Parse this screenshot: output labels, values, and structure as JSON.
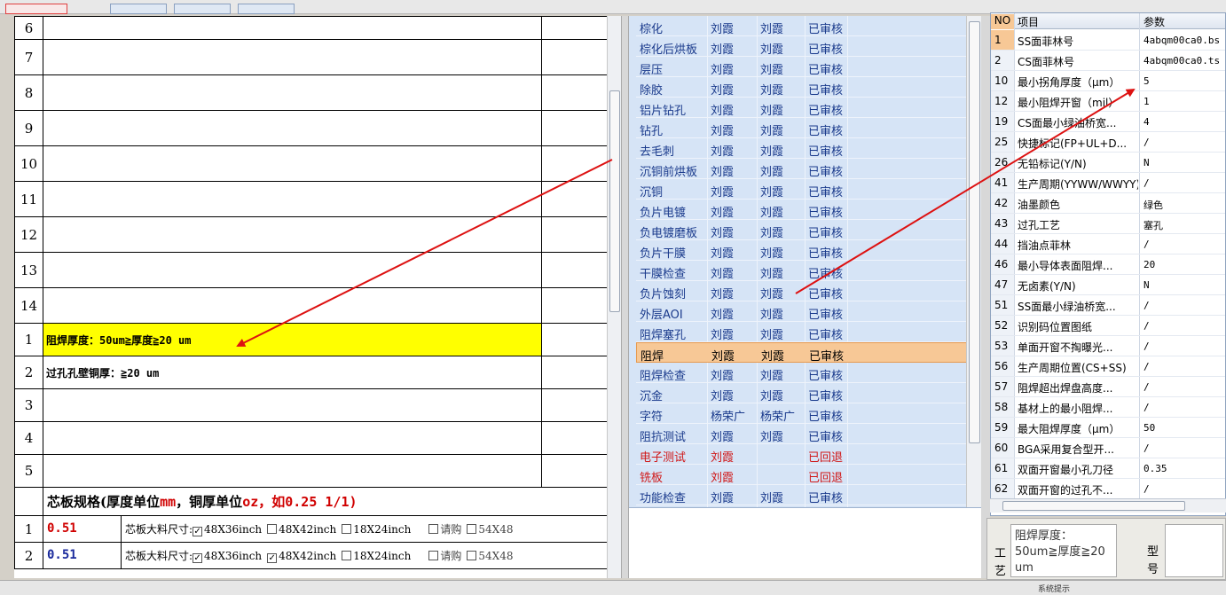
{
  "left_sheet": {
    "top_rows": [
      {
        "num": "6",
        "text": ""
      },
      {
        "num": "7",
        "text": ""
      },
      {
        "num": "8",
        "text": ""
      },
      {
        "num": "9",
        "text": ""
      },
      {
        "num": "10",
        "text": ""
      },
      {
        "num": "11",
        "text": ""
      },
      {
        "num": "12",
        "text": ""
      },
      {
        "num": "13",
        "text": ""
      },
      {
        "num": "14",
        "text": ""
      }
    ],
    "notes": [
      {
        "num": "1",
        "text": "阻焊厚度：50um≧厚度≧20 um",
        "highlight": true
      },
      {
        "num": "2",
        "text": "过孔孔壁铜厚：≧20 um",
        "highlight": false
      },
      {
        "num": "3",
        "text": "",
        "highlight": false
      },
      {
        "num": "4",
        "text": "",
        "highlight": false
      },
      {
        "num": "5",
        "text": "",
        "highlight": false
      }
    ],
    "spec_title_a": "芯板规格(厚度单位",
    "spec_unit_a": "mm",
    "spec_title_b": "，铜厚单位",
    "spec_unit_b": "oz",
    "spec_title_c": "，如0.25 1/1)",
    "core_rows": [
      {
        "num": "1",
        "value": "0.51",
        "value_color": "#d00000",
        "label": "芯板大料尺寸:",
        "opt1": "48X36inch",
        "opt1_checked": "✓",
        "opt2": "48X42inch",
        "opt2_checked": "",
        "opt3": "18X24inch",
        "opt4": "请购",
        "opt5": "54X48"
      },
      {
        "num": "2",
        "value": "0.51",
        "value_color": "#1a2a9c",
        "label": "芯板大料尺寸:",
        "opt1": "48X36inch",
        "opt1_checked": "✓",
        "opt2": "48X42inch",
        "opt2_checked": "✓",
        "opt3": "18X24inch",
        "opt4": "请购",
        "opt5": "54X48"
      }
    ]
  },
  "process_list": {
    "rows": [
      {
        "name": "棕化",
        "op1": "刘霞",
        "op2": "刘霞",
        "status": "已审核",
        "state": "ok"
      },
      {
        "name": "棕化后烘板",
        "op1": "刘霞",
        "op2": "刘霞",
        "status": "已审核",
        "state": "ok"
      },
      {
        "name": "层压",
        "op1": "刘霞",
        "op2": "刘霞",
        "status": "已审核",
        "state": "ok"
      },
      {
        "name": "除胶",
        "op1": "刘霞",
        "op2": "刘霞",
        "status": "已审核",
        "state": "ok"
      },
      {
        "name": "铝片钻孔",
        "op1": "刘霞",
        "op2": "刘霞",
        "status": "已审核",
        "state": "ok"
      },
      {
        "name": "钻孔",
        "op1": "刘霞",
        "op2": "刘霞",
        "status": "已审核",
        "state": "ok"
      },
      {
        "name": "去毛刺",
        "op1": "刘霞",
        "op2": "刘霞",
        "status": "已审核",
        "state": "ok"
      },
      {
        "name": "沉铜前烘板",
        "op1": "刘霞",
        "op2": "刘霞",
        "status": "已审核",
        "state": "ok"
      },
      {
        "name": "沉铜",
        "op1": "刘霞",
        "op2": "刘霞",
        "status": "已审核",
        "state": "ok"
      },
      {
        "name": "负片电镀",
        "op1": "刘霞",
        "op2": "刘霞",
        "status": "已审核",
        "state": "ok"
      },
      {
        "name": "负电镀磨板",
        "op1": "刘霞",
        "op2": "刘霞",
        "status": "已审核",
        "state": "ok"
      },
      {
        "name": "负片干膜",
        "op1": "刘霞",
        "op2": "刘霞",
        "status": "已审核",
        "state": "ok"
      },
      {
        "name": "干膜检查",
        "op1": "刘霞",
        "op2": "刘霞",
        "status": "已审核",
        "state": "ok"
      },
      {
        "name": "负片蚀刻",
        "op1": "刘霞",
        "op2": "刘霞",
        "status": "已审核",
        "state": "ok"
      },
      {
        "name": "外层AOI",
        "op1": "刘霞",
        "op2": "刘霞",
        "status": "已审核",
        "state": "ok"
      },
      {
        "name": "阻焊塞孔",
        "op1": "刘霞",
        "op2": "刘霞",
        "status": "已审核",
        "state": "ok"
      },
      {
        "name": "阻焊",
        "op1": "刘霞",
        "op2": "刘霞",
        "status": "已审核",
        "state": "sel"
      },
      {
        "name": "阻焊检查",
        "op1": "刘霞",
        "op2": "刘霞",
        "status": "已审核",
        "state": "ok"
      },
      {
        "name": "沉金",
        "op1": "刘霞",
        "op2": "刘霞",
        "status": "已审核",
        "state": "ok"
      },
      {
        "name": "字符",
        "op1": "杨荣广",
        "op2": "杨荣广",
        "status": "已审核",
        "state": "ok"
      },
      {
        "name": "阻抗测试",
        "op1": "刘霞",
        "op2": "刘霞",
        "status": "已审核",
        "state": "ok"
      },
      {
        "name": "电子测试",
        "op1": "刘霞",
        "op2": "",
        "status": "已回退",
        "state": "back"
      },
      {
        "name": "铣板",
        "op1": "刘霞",
        "op2": "",
        "status": "已回退",
        "state": "back"
      },
      {
        "name": "功能检查",
        "op1": "刘霞",
        "op2": "刘霞",
        "status": "已审核",
        "state": "ok"
      }
    ]
  },
  "param_grid": {
    "headers": {
      "no": "NO",
      "item": "项目",
      "value": "参数"
    },
    "rows": [
      {
        "no": "1",
        "item": "SS面菲林号",
        "value": "4abqm00ca0.bs"
      },
      {
        "no": "2",
        "item": "CS面菲林号",
        "value": "4abqm00ca0.ts"
      },
      {
        "no": "10",
        "item": "最小拐角厚度（μm）",
        "value": "5"
      },
      {
        "no": "12",
        "item": "最小阻焊开窗（mil）",
        "value": "1"
      },
      {
        "no": "19",
        "item": "CS面最小绿油桥宽...",
        "value": "4"
      },
      {
        "no": "25",
        "item": "快捷标记(FP+UL+D...",
        "value": "/"
      },
      {
        "no": "26",
        "item": "无铅标记(Y/N)",
        "value": "N"
      },
      {
        "no": "41",
        "item": "生产周期(YYWW/WWYY)",
        "value": "/"
      },
      {
        "no": "42",
        "item": "油墨颜色",
        "value": "绿色"
      },
      {
        "no": "43",
        "item": "过孔工艺",
        "value": "塞孔"
      },
      {
        "no": "44",
        "item": "挡油点菲林",
        "value": "/"
      },
      {
        "no": "46",
        "item": "最小导体表面阻焊...",
        "value": "20"
      },
      {
        "no": "47",
        "item": "无卤素(Y/N)",
        "value": "N"
      },
      {
        "no": "51",
        "item": "SS面最小绿油桥宽...",
        "value": "/"
      },
      {
        "no": "52",
        "item": "识别码位置图纸",
        "value": "/"
      },
      {
        "no": "53",
        "item": "单面开窗不掏曝光...",
        "value": "/"
      },
      {
        "no": "56",
        "item": "生产周期位置(CS+SS)",
        "value": "/"
      },
      {
        "no": "57",
        "item": "阻焊超出焊盘高度...",
        "value": "/"
      },
      {
        "no": "58",
        "item": "基材上的最小阻焊...",
        "value": "/"
      },
      {
        "no": "59",
        "item": "最大阻焊厚度（μm）",
        "value": "50"
      },
      {
        "no": "60",
        "item": "BGA采用复合型开...",
        "value": "/"
      },
      {
        "no": "61",
        "item": "双面开窗最小孔刀径",
        "value": "0.35"
      },
      {
        "no": "62",
        "item": "双面开窗的过孔不...",
        "value": "/"
      }
    ]
  },
  "bottom_panel": {
    "label_a": "工艺",
    "process_note": "阻焊厚度：50um≧厚度≧20 um",
    "label_b": "型号"
  },
  "taskbar": {
    "tray_text": "系统提示"
  },
  "colors": {
    "annotation_arrow": "#dd1111",
    "highlight": "#ffff00",
    "selected_row": "#f7c896"
  }
}
